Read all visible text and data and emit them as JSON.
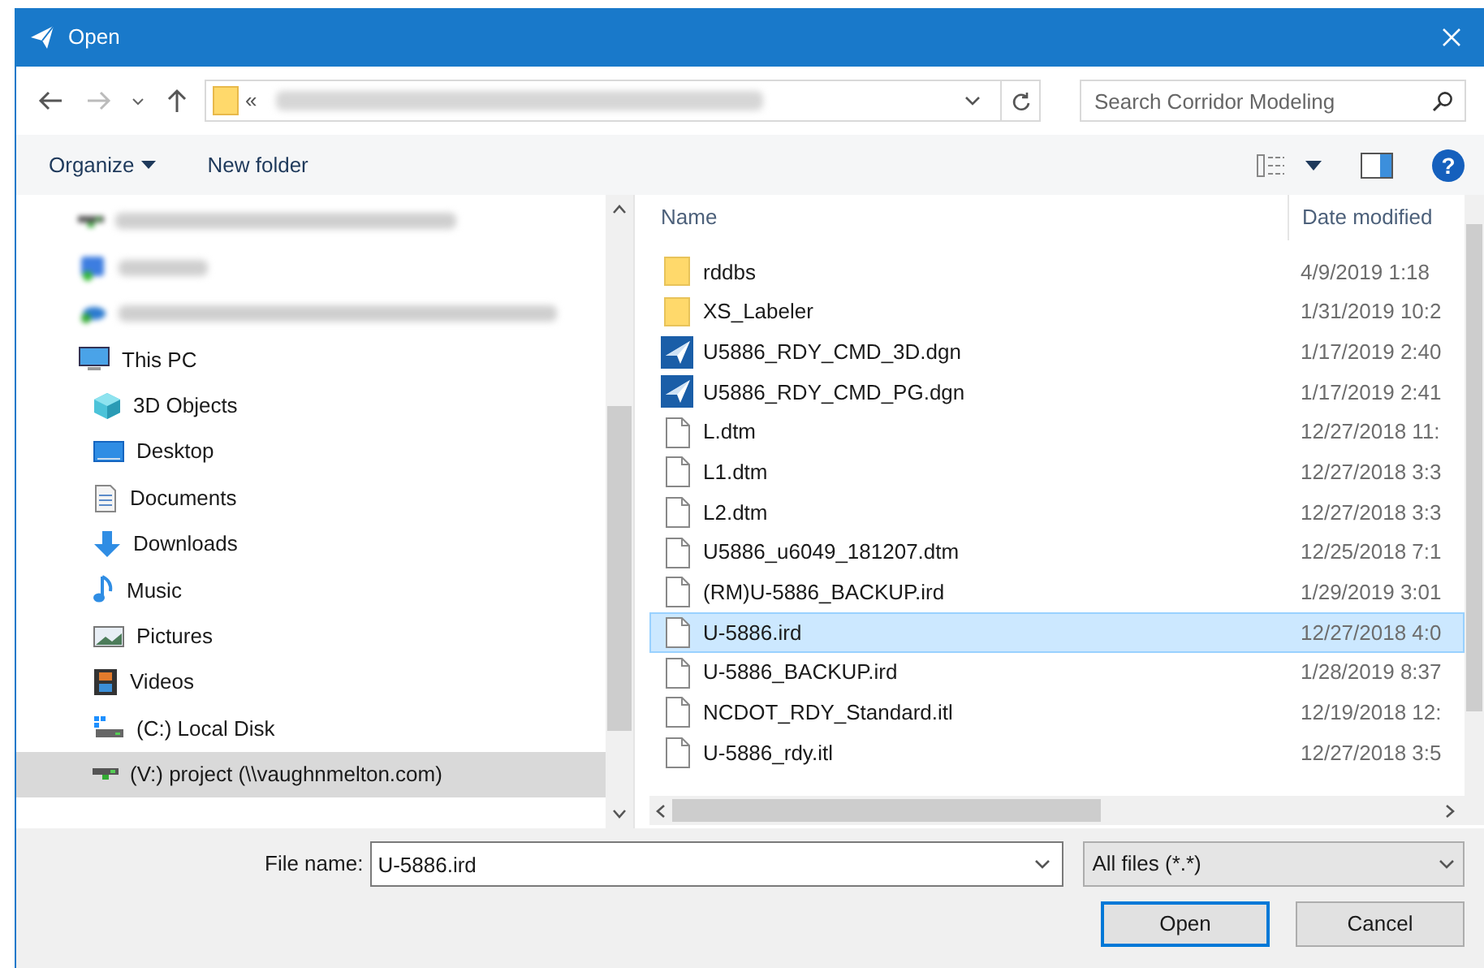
{
  "window": {
    "title": "Open"
  },
  "address": {
    "prefix": "«"
  },
  "search": {
    "placeholder": "Search Corridor Modeling"
  },
  "toolbar": {
    "organize": "Organize",
    "new_folder": "New folder",
    "help": "?"
  },
  "sidebar": {
    "items": [
      {
        "kind": "network",
        "blurred": true,
        "selected": false
      },
      {
        "kind": "dropbox",
        "blurred": true,
        "selected": false
      },
      {
        "kind": "onedrive",
        "blurred": true,
        "selected": false
      },
      {
        "kind": "pc",
        "label": "This PC",
        "blurred": false,
        "selected": false,
        "children": [
          {
            "kind": "objects",
            "label": "3D Objects",
            "blurred": false,
            "selected": false
          },
          {
            "kind": "desktop",
            "label": "Desktop",
            "blurred": false,
            "selected": false
          },
          {
            "kind": "documents",
            "label": "Documents",
            "blurred": false,
            "selected": false
          },
          {
            "kind": "downloads",
            "label": "Downloads",
            "blurred": false,
            "selected": false
          },
          {
            "kind": "music",
            "label": "Music",
            "blurred": false,
            "selected": false
          },
          {
            "kind": "pictures",
            "label": "Pictures",
            "blurred": false,
            "selected": false
          },
          {
            "kind": "videos",
            "label": "Videos",
            "blurred": false,
            "selected": false
          },
          {
            "kind": "disk",
            "label": "(C:) Local Disk",
            "blurred": false,
            "selected": false
          },
          {
            "kind": "network",
            "label": "(V:) project (\\\\vaughnmelton.com)",
            "blurred": false,
            "selected": true
          }
        ]
      }
    ]
  },
  "files": {
    "columns": [
      "Name",
      "Date modified"
    ],
    "rows": [
      {
        "kind": "folder",
        "name": "rddbs",
        "date": "4/9/2019 1:18",
        "selected": false
      },
      {
        "kind": "folder",
        "name": "XS_Labeler",
        "date": "1/31/2019 10:2",
        "selected": false
      },
      {
        "kind": "dgn",
        "name": "U5886_RDY_CMD_3D.dgn",
        "date": "1/17/2019 2:40",
        "selected": false
      },
      {
        "kind": "dgn",
        "name": "U5886_RDY_CMD_PG.dgn",
        "date": "1/17/2019 2:41",
        "selected": false
      },
      {
        "kind": "file",
        "name": "L.dtm",
        "date": "12/27/2018 11:",
        "selected": false
      },
      {
        "kind": "file",
        "name": "L1.dtm",
        "date": "12/27/2018 3:3",
        "selected": false
      },
      {
        "kind": "file",
        "name": "L2.dtm",
        "date": "12/27/2018 3:3",
        "selected": false
      },
      {
        "kind": "file",
        "name": "U5886_u6049_181207.dtm",
        "date": "12/25/2018 7:1",
        "selected": false
      },
      {
        "kind": "file",
        "name": "(RM)U-5886_BACKUP.ird",
        "date": "1/29/2019 3:01",
        "selected": false
      },
      {
        "kind": "file",
        "name": "U-5886.ird",
        "date": "12/27/2018 4:0",
        "selected": true
      },
      {
        "kind": "file",
        "name": "U-5886_BACKUP.ird",
        "date": "1/28/2019 8:37",
        "selected": false
      },
      {
        "kind": "file",
        "name": "NCDOT_RDY_Standard.itl",
        "date": "12/19/2018 12:",
        "selected": false
      },
      {
        "kind": "file",
        "name": "U-5886_rdy.itl",
        "date": "12/27/2018 3:5",
        "selected": false
      }
    ]
  },
  "footer": {
    "file_name_label": "File name:",
    "file_name": "U-5886.ird",
    "filter": "All files (*.*)",
    "buttons": [
      {
        "label": "Open",
        "default": true
      },
      {
        "label": "Cancel",
        "default": false
      }
    ]
  }
}
